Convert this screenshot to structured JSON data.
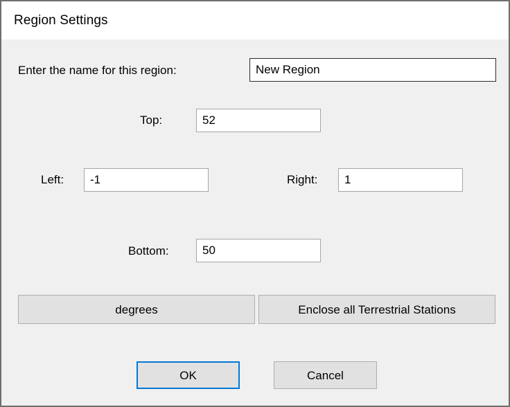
{
  "window": {
    "title": "Region Settings"
  },
  "form": {
    "name_label": "Enter the name for this region:",
    "name_value": "New Region",
    "name_placeholder": "",
    "top_label": "Top:",
    "top_value": "52",
    "left_label": "Left:",
    "left_value": "-1",
    "right_label": "Right:",
    "right_value": "1",
    "bottom_label": "Bottom:",
    "bottom_value": "50"
  },
  "actions": {
    "units_label": "degrees",
    "enclose_label": "Enclose all Terrestrial Stations"
  },
  "footer": {
    "ok_label": "OK",
    "cancel_label": "Cancel"
  },
  "colors": {
    "accent": "#0078d7",
    "window_border": "#6e6e6e",
    "dialog_background": "#f0f0f0",
    "button_face": "#e1e1e1",
    "field_background": "#ffffff"
  }
}
